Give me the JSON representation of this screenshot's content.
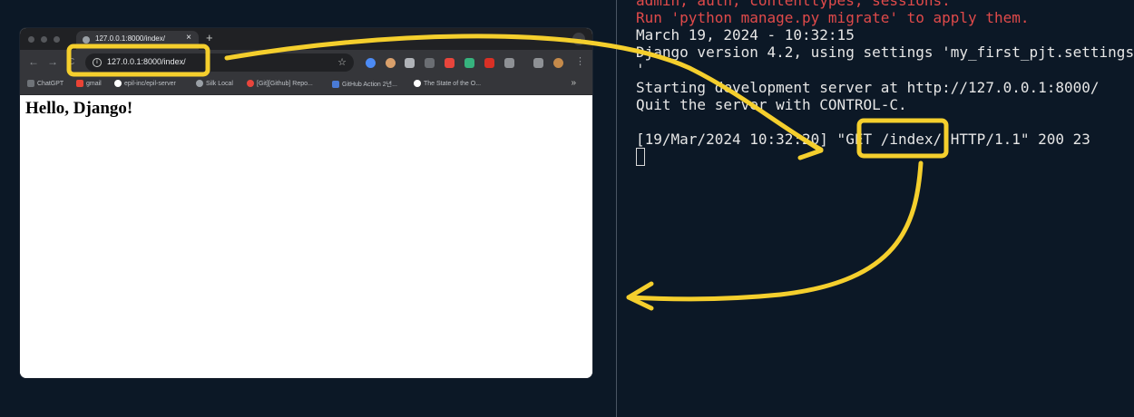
{
  "browser": {
    "tab_title": "127.0.0.1:8000/index/",
    "tab_close": "×",
    "new_tab": "+",
    "tab_menu": "⌄",
    "back": "←",
    "forward": "→",
    "reload": "C",
    "info": "i",
    "url": "127.0.0.1:8000/index/",
    "star": "☆",
    "menu": "⋮",
    "bookmarks": [
      {
        "label": "ChatGPT",
        "icon": "chatgpt-icon",
        "color": "#9aa0a6"
      },
      {
        "label": "gmail",
        "icon": "gmail-icon",
        "color": "#ea4335"
      },
      {
        "label": "epil-inc/epil-server",
        "icon": "github-icon",
        "color": "#ffffff"
      },
      {
        "label": "Silk Local",
        "icon": "globe-icon",
        "color": "#9aa0a6"
      },
      {
        "label": "[Git][Github] Repo...",
        "icon": "t-icon",
        "color": "#e8453c"
      },
      {
        "label": "GitHub Action 2년...",
        "icon": "bookmark-icon",
        "color": "#4a7bd6"
      },
      {
        "label": "The State of the O...",
        "icon": "github-icon",
        "color": "#ffffff"
      }
    ],
    "bookmarks_more": "»",
    "page_heading": "Hello, Django!"
  },
  "terminal": {
    "lines": [
      {
        "text": "admin, auth, contenttypes, sessions.",
        "color": "#e04a4a"
      },
      {
        "text": "Run 'python manage.py migrate' to apply them.",
        "color": "#e04a4a"
      },
      {
        "text": "March 19, 2024 - 10:32:15",
        "color": "#e6e6e6"
      },
      {
        "text": "Django version 4.2, using settings 'my_first_pjt.settings",
        "color": "#e6e6e6"
      },
      {
        "text": "'",
        "color": "#e6e6e6"
      },
      {
        "text": "Starting development server at http://127.0.0.1:8000/",
        "color": "#e6e6e6"
      },
      {
        "text": "Quit the server with CONTROL-C.",
        "color": "#e6e6e6"
      },
      {
        "text": "",
        "color": "#e6e6e6"
      },
      {
        "text": "[19/Mar/2024 10:32:20] \"GET /index/ HTTP/1.1\" 200 23",
        "color": "#e6e6e6"
      }
    ]
  },
  "annotation": {
    "color": "#f5cf2d"
  }
}
